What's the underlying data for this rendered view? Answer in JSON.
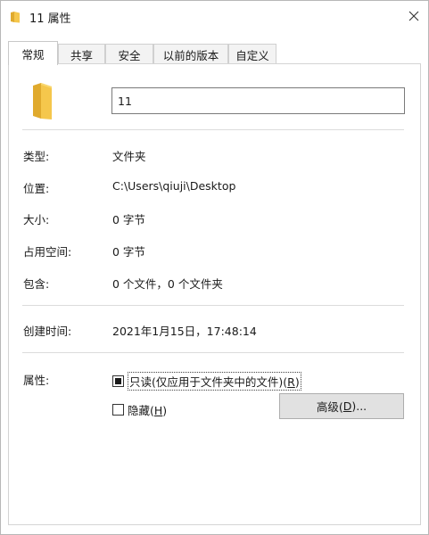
{
  "window": {
    "title": "11 属性",
    "close_glyph": "✕"
  },
  "tabs": [
    {
      "label": "常规",
      "active": true
    },
    {
      "label": "共享",
      "active": false
    },
    {
      "label": "安全",
      "active": false
    },
    {
      "label": "以前的版本",
      "active": false
    },
    {
      "label": "自定义",
      "active": false
    }
  ],
  "general": {
    "name_value": "11",
    "rows": {
      "type": {
        "label": "类型:",
        "value": "文件夹"
      },
      "location": {
        "label": "位置:",
        "value": "C:\\Users\\qiuji\\Desktop"
      },
      "size": {
        "label": "大小:",
        "value": "0 字节"
      },
      "size_on_disk": {
        "label": "占用空间:",
        "value": "0 字节"
      },
      "contains": {
        "label": "包含:",
        "value": "0 个文件，0 个文件夹"
      },
      "created": {
        "label": "创建时间:",
        "value": "2021年1月15日，17:48:14"
      }
    },
    "attributes": {
      "label": "属性:",
      "readonly": {
        "text": "只读(仅应用于文件夹中的文件)(",
        "access_key": "R",
        "text_end": ")",
        "state": "indeterminate"
      },
      "hidden": {
        "text": "隐藏(",
        "access_key": "H",
        "text_end": ")",
        "state": "unchecked"
      },
      "advanced_button": {
        "text": "高级(",
        "access_key": "D",
        "text_end": ")..."
      }
    }
  },
  "colors": {
    "folder_yellow": "#f5c74c",
    "folder_dark": "#e0aa2d",
    "button_face": "#e1e1e1",
    "border": "#adadad"
  },
  "icons": {
    "title": "folder-icon",
    "large": "folder-icon",
    "close": "close-icon"
  }
}
